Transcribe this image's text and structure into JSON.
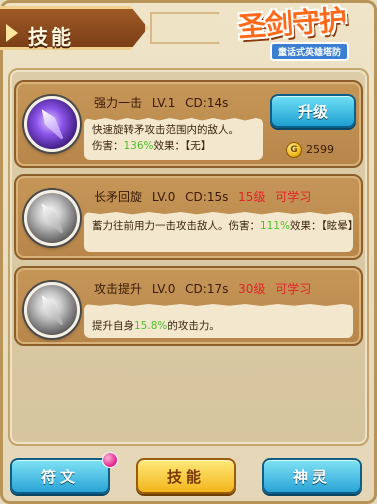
{
  "header": {
    "title": "技能",
    "logo_text": "圣剑守护",
    "logo_subtitle": "童话式英雄塔防"
  },
  "skills": [
    {
      "name": "强力一击",
      "level": "LV.1",
      "cooldown": "CD:14s",
      "icon": "purple-blade-icon",
      "desc_line1": "快速旋转矛攻击范围内的敌人。",
      "damage_label": "伤害：",
      "damage_value": "136%",
      "effect_label": "效果：",
      "effect_value": "【无】",
      "upgrade_label": "升级",
      "cost": "2599"
    },
    {
      "name": "长矛回旋",
      "level": "LV.0",
      "cooldown": "CD:15s",
      "unlock_level": "15级",
      "unlock_note": "可学习",
      "icon": "spear-spin-icon",
      "desc_prefix": "蓄力往前用力一击攻击敌人。伤害：",
      "damage_value": "111%",
      "desc_suffix": "效果：【眩晕】"
    },
    {
      "name": "攻击提升",
      "level": "LV.0",
      "cooldown": "CD:17s",
      "unlock_level": "30级",
      "unlock_note": "可学习",
      "icon": "attack-up-icon",
      "desc_prefix": "提升自身",
      "boost_value": "15.8%",
      "desc_suffix": "的攻击力。"
    }
  ],
  "tabs": [
    {
      "label": "符文",
      "state": "inactive"
    },
    {
      "label": "技能",
      "state": "active"
    },
    {
      "label": "神灵",
      "state": "inactive"
    }
  ],
  "colors": {
    "highlight_green": "#4fbf2a",
    "lock_red": "#e3232a",
    "tab_blue": "#2aa4d6",
    "tab_gold": "#f3b51c"
  }
}
